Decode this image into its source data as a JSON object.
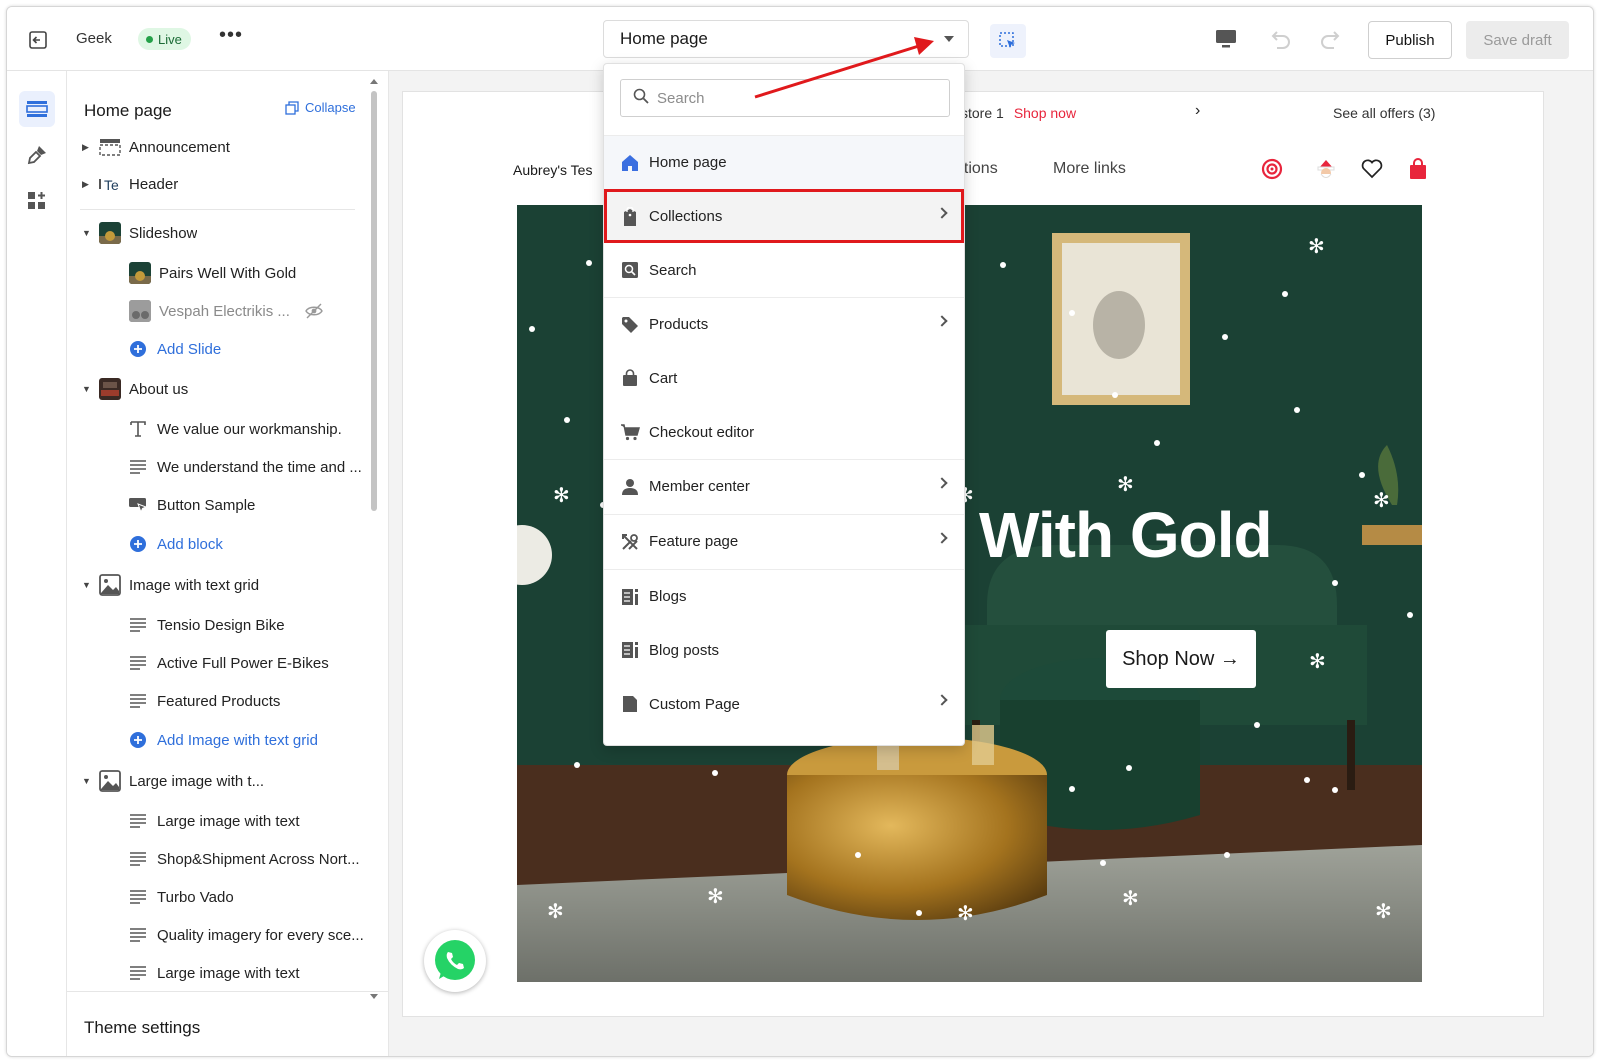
{
  "topbar": {
    "store_name": "Geek",
    "status_badge": "Live",
    "more_label": "•••",
    "page_selector": "Home page",
    "publish_label": "Publish",
    "save_draft_label": "Save draft"
  },
  "sidebar": {
    "title": "Home page",
    "collapse_label": "Collapse",
    "sections": {
      "announcement": "Announcement",
      "header": "Header",
      "slideshow": "Slideshow",
      "slide_1": "Pairs Well With Gold",
      "slide_2": "Vespah Electrikis ...",
      "add_slide": "Add Slide",
      "about_us": "About us",
      "about_b1": "We value our workmanship.",
      "about_b2": "We understand the time and ...",
      "about_b3": "Button Sample",
      "add_block": "Add block",
      "image_grid": "Image with text grid",
      "grid_b1": "Tensio Design Bike",
      "grid_b2": "Active Full Power E-Bikes",
      "grid_b3": "Featured Products",
      "add_grid": "Add Image with text grid",
      "large_image": "Large image with t...",
      "large_b1": "Large image with text",
      "large_b2": "Shop&Shipment Across Nort...",
      "large_b3": "Turbo Vado",
      "large_b4": "Quality imagery for every sce...",
      "large_b5": "Large image with text"
    },
    "theme_settings": "Theme settings"
  },
  "dropdown": {
    "search_placeholder": "Search",
    "items": [
      {
        "label": "Home page",
        "icon": "home-icon",
        "has_submenu": false,
        "selected": true
      },
      {
        "label": "Collections",
        "icon": "collections-icon",
        "has_submenu": true,
        "highlighted": true
      },
      {
        "label": "Search",
        "icon": "search-page-icon",
        "has_submenu": false
      },
      {
        "label": "Products",
        "icon": "tag-icon",
        "has_submenu": true
      },
      {
        "label": "Cart",
        "icon": "bag-icon",
        "has_submenu": false
      },
      {
        "label": "Checkout editor",
        "icon": "cart-icon",
        "has_submenu": false
      },
      {
        "label": "Member center",
        "icon": "person-icon",
        "has_submenu": true
      },
      {
        "label": "Feature page",
        "icon": "tools-icon",
        "has_submenu": true
      },
      {
        "label": "Blogs",
        "icon": "blog-icon",
        "has_submenu": false
      },
      {
        "label": "Blog posts",
        "icon": "blog-icon",
        "has_submenu": false
      },
      {
        "label": "Custom Page",
        "icon": "page-icon",
        "has_submenu": true
      }
    ]
  },
  "preview": {
    "announcement_text": "store 1",
    "announcement_link": "Shop now",
    "announcement_offers": "See all offers (3)",
    "store_name": "Aubrey's Tes",
    "nav_link_1": "ections",
    "nav_link_2": "More links",
    "hero_title": "With Gold",
    "hero_button": "Shop Now →"
  },
  "colors": {
    "accent_blue": "#2f6fdb",
    "highlight_red": "#e0191c",
    "live_green": "#24a148",
    "hero_green": "#1c4236"
  }
}
